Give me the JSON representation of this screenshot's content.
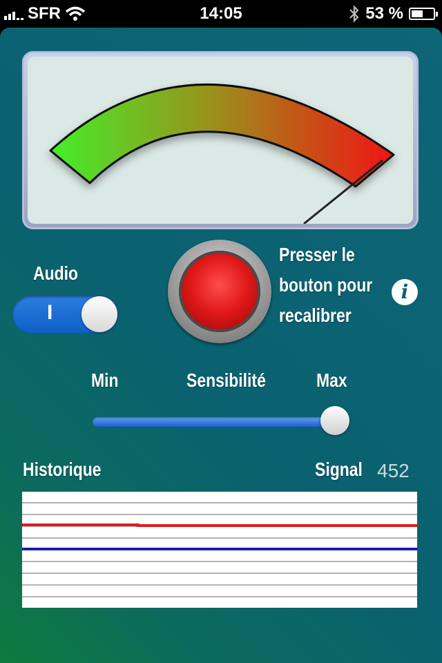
{
  "status_bar": {
    "carrier": "SFR",
    "time": "14:05",
    "battery_text": "53 %",
    "battery_level": 0.53,
    "icons": [
      "signal-bars-icon",
      "wifi-icon",
      "bluetooth-icon",
      "battery-charging-icon"
    ]
  },
  "gauge": {
    "needle_level": 1.0,
    "colors": {
      "low": "#44ee2a",
      "mid": "#a08a1c",
      "high": "#f01414"
    }
  },
  "audio": {
    "label": "Audio",
    "toggle_text": "I",
    "on": true
  },
  "recalibrate": {
    "text_line1": "Presser le",
    "text_line2": "bouton pour",
    "text_line3": "recalibrer"
  },
  "info_icon": {
    "glyph": "i"
  },
  "sensitivity": {
    "min_label": "Min",
    "label": "Sensibilité",
    "max_label": "Max",
    "level": 1.0
  },
  "history": {
    "title": "Historique",
    "signal_label": "Signal",
    "signal_value": "452",
    "series_colors": {
      "upper": "#e21b1b",
      "lower": "#1c1ca8"
    }
  }
}
